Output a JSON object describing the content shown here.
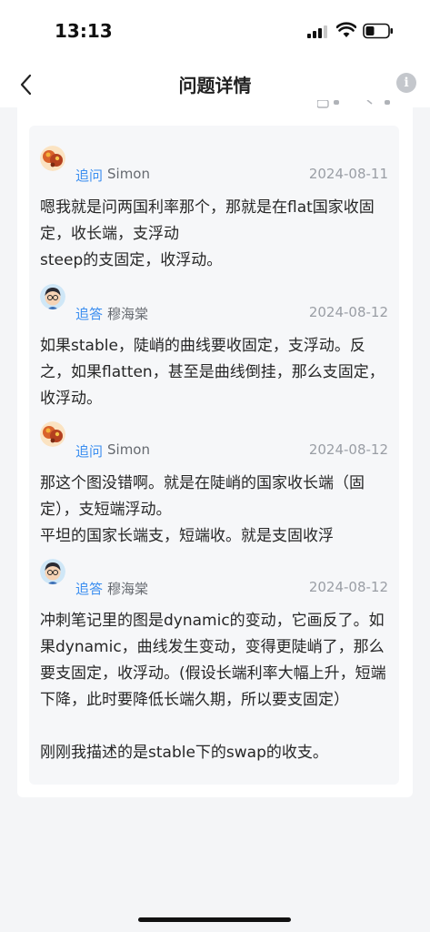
{
  "status_bar": {
    "time": "13:13"
  },
  "nav": {
    "title": "问题详情"
  },
  "thread": [
    {
      "tag": "追问",
      "user": "Simon",
      "date": "2024-08-11",
      "text": "嗯我就是问两国利率那个，那就是在flat国家收固定，收长端，支浮动\nsteep的支固定，收浮动。",
      "avatar": "food-avatar"
    },
    {
      "tag": "追答",
      "user": "穆海棠",
      "date": "2024-08-12",
      "text": "如果stable，陡峭的曲线要收固定，支浮动。反之，如果flatten，甚至是曲线倒挂，那么支固定，收浮动。",
      "avatar": "teacher-avatar"
    },
    {
      "tag": "追问",
      "user": "Simon",
      "date": "2024-08-12",
      "text": "那这个图没错啊。就是在陡峭的国家收长端（固定），支短端浮动。\n平坦的国家长端支，短端收。就是支固收浮",
      "avatar": "food-avatar"
    },
    {
      "tag": "追答",
      "user": "穆海棠",
      "date": "2024-08-12",
      "text": "冲刺笔记里的图是dynamic的变动，它画反了。如果dynamic，曲线发生变动，变得更陡峭了，那么要支固定，收浮动。(假设长端利率大幅上升，短端下降，此时要降低长端久期，所以要支固定）\n\n刚刚我描述的是stable下的swap的收支。",
      "avatar": "teacher-avatar"
    }
  ]
}
